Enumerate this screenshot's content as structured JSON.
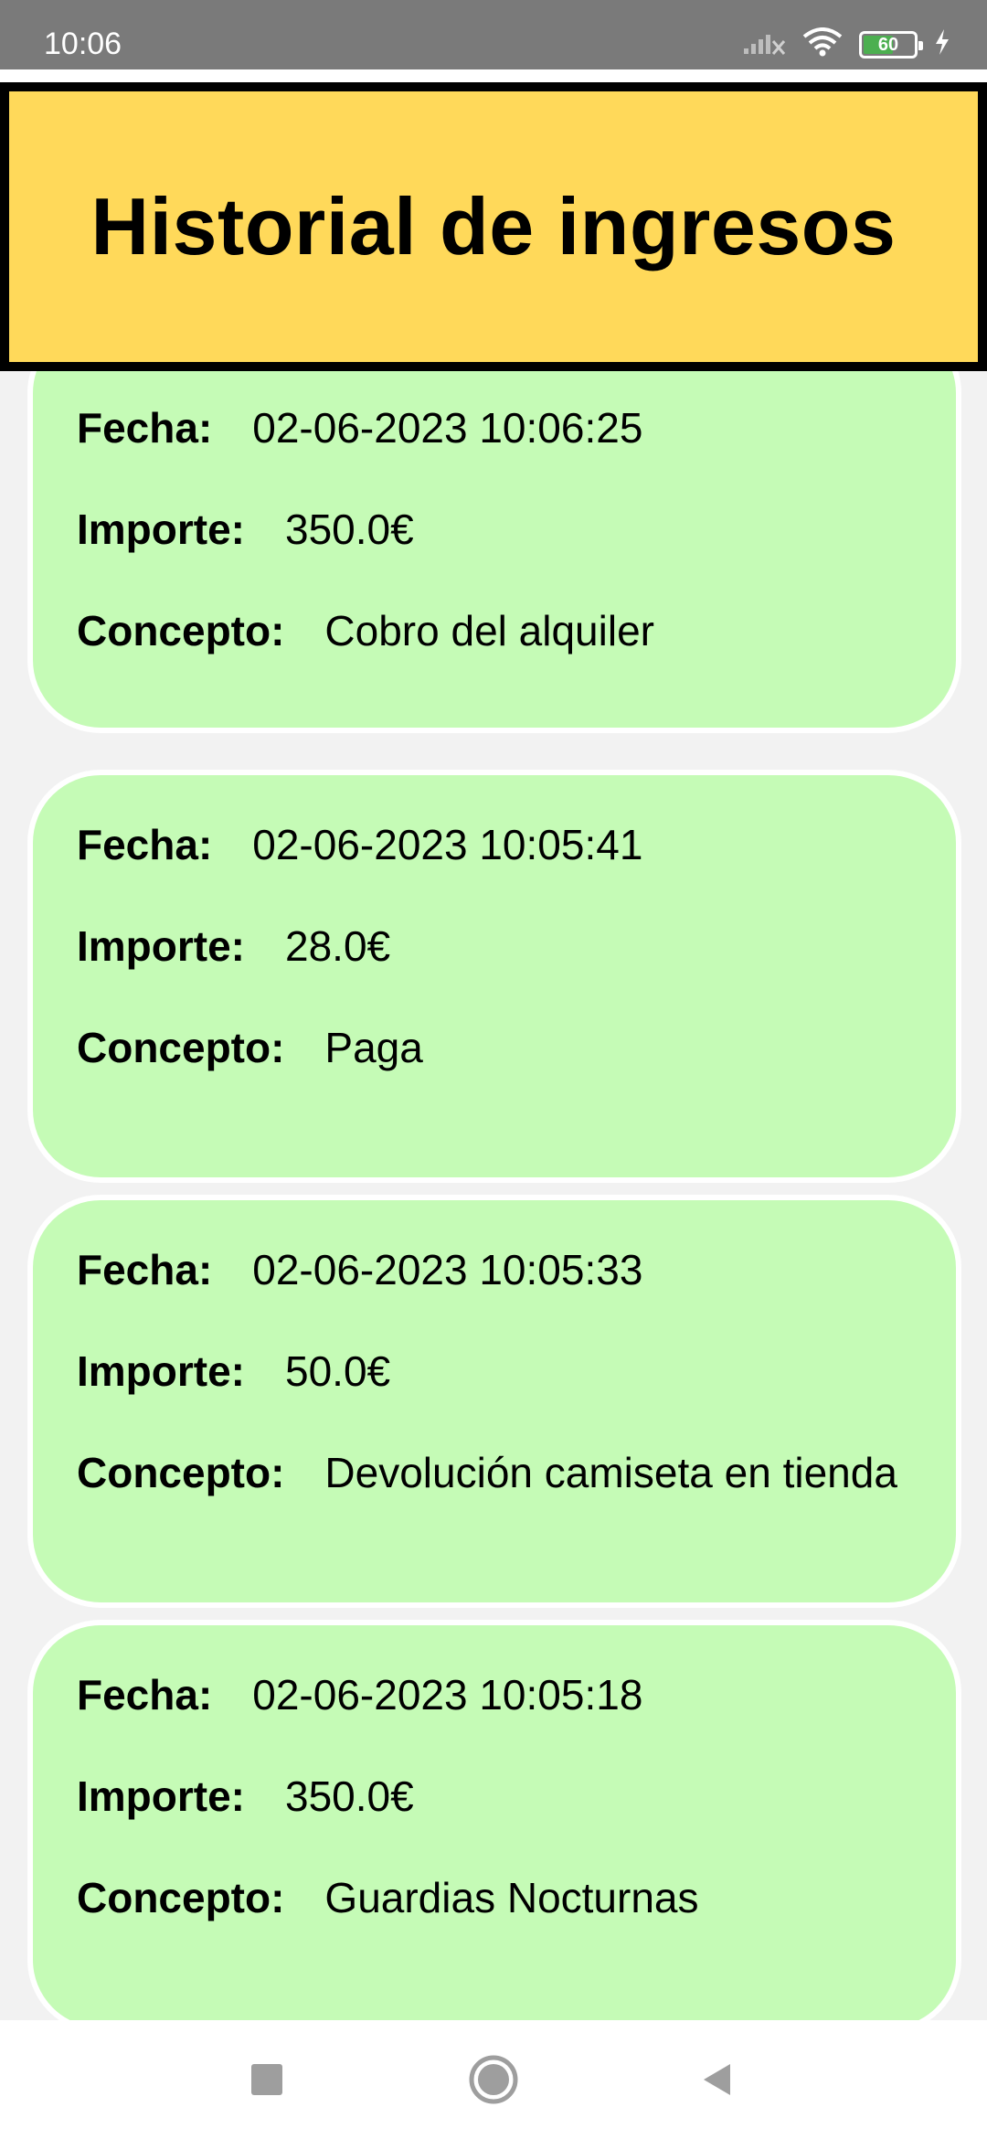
{
  "status_bar": {
    "time": "10:06",
    "battery_level": "60",
    "battery_fraction": 0.6,
    "icons": [
      "signal-off-icon",
      "wifi-icon",
      "battery-icon",
      "charging-bolt-icon"
    ]
  },
  "header": {
    "title": "Historial de ingresos"
  },
  "labels": {
    "fecha": "Fecha:",
    "importe": "Importe:",
    "concepto": "Concepto:"
  },
  "records": [
    {
      "fecha": "02-06-2023 10:06:25",
      "importe": "350.0€",
      "concepto": "Cobro del alquiler"
    },
    {
      "fecha": "02-06-2023 10:05:41",
      "importe": "28.0€",
      "concepto": "Paga"
    },
    {
      "fecha": "02-06-2023 10:05:33",
      "importe": "50.0€",
      "concepto": "Devolución camiseta en tienda"
    },
    {
      "fecha": "02-06-2023 10:05:18",
      "importe": "350.0€",
      "concepto": "Guardias Nocturnas"
    }
  ],
  "nav_bar": {
    "buttons": [
      "recents-square-icon",
      "home-circle-icon",
      "back-triangle-icon"
    ]
  },
  "colors": {
    "header_bg": "#ffd95a",
    "card_bg": "#c5fbb6",
    "status_bg": "#7a7a7a",
    "page_bg": "#f2f2f2"
  }
}
